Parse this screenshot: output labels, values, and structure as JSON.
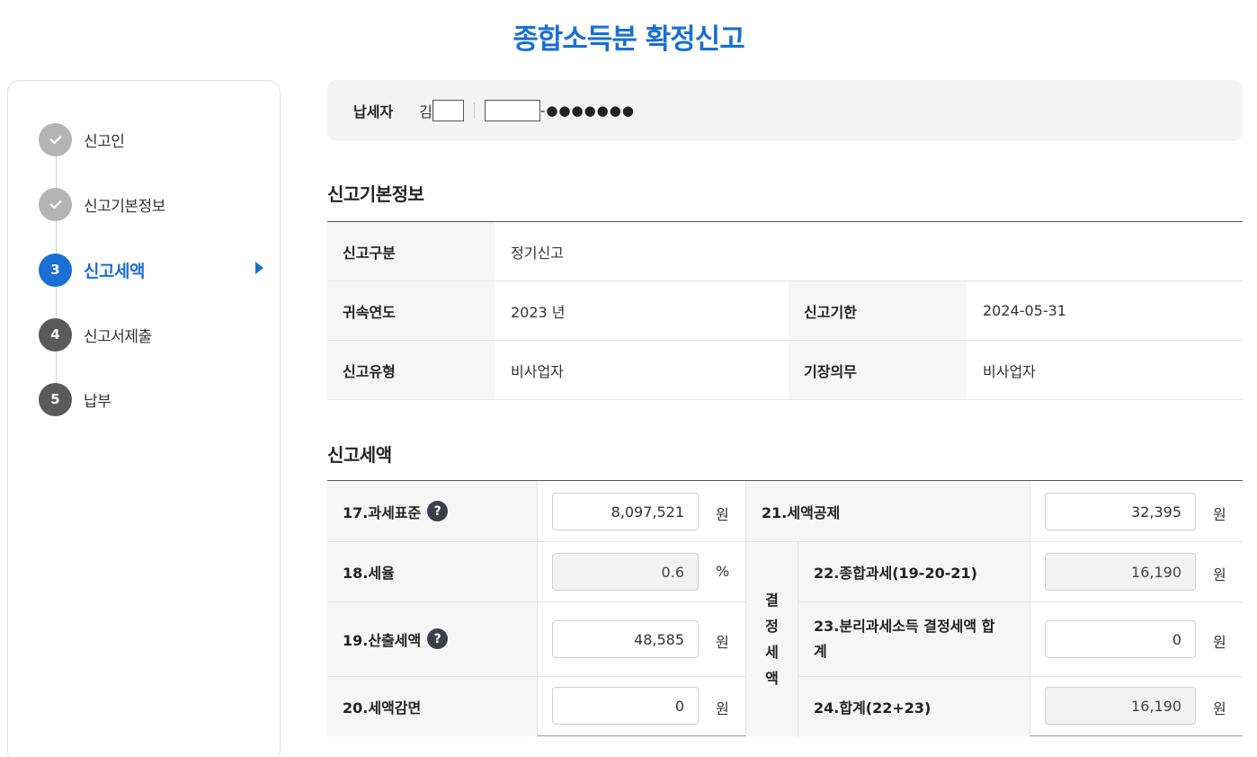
{
  "page": {
    "title": "종합소득분 확정신고"
  },
  "sidebar": {
    "steps": [
      {
        "num": "",
        "label": "신고인",
        "state": "done"
      },
      {
        "num": "",
        "label": "신고기본정보",
        "state": "done"
      },
      {
        "num": "3",
        "label": "신고세액",
        "state": "active"
      },
      {
        "num": "4",
        "label": "신고서제출",
        "state": "todo"
      },
      {
        "num": "5",
        "label": "납부",
        "state": "todo"
      }
    ]
  },
  "taxpayer": {
    "label": "납세자",
    "name_prefix": "김",
    "id_suffix": "-●●●●●●●"
  },
  "basic_info": {
    "section_title": "신고기본정보",
    "report_type_label": "신고구분",
    "report_type_value": "정기신고",
    "year_label": "귀속연도",
    "year_value": "2023 년",
    "deadline_label": "신고기한",
    "deadline_value": "2024-05-31",
    "filer_type_label": "신고유형",
    "filer_type_value": "비사업자",
    "bookkeeping_label": "기장의무",
    "bookkeeping_value": "비사업자"
  },
  "tax": {
    "section_title": "신고세액",
    "tax_base_label": "17.과세표준",
    "tax_base_value": "8,097,521",
    "tax_rate_label": "18.세율",
    "tax_rate_value": "0.6",
    "calc_tax_label": "19.산출세액",
    "calc_tax_value": "48,585",
    "reduction_label": "20.세액감면",
    "reduction_value": "0",
    "credit_label": "21.세액공제",
    "credit_value": "32,395",
    "determined_label_chars": [
      "결",
      "정",
      "세",
      "액"
    ],
    "comprehensive_label": "22.종합과세(19-20-21)",
    "comprehensive_value": "16,190",
    "separate_label_line1": "23.분리과세소득 결정세액 합",
    "separate_label_line2": "계",
    "separate_value": "0",
    "total_label": "24.합계(22+23)",
    "total_value": "16,190",
    "unit_won": "원",
    "unit_percent": "%",
    "help_glyph": "?"
  },
  "colors": {
    "accent": "#1a6fd4",
    "done_step": "#b4b4b4",
    "todo_step": "#5a5a5a",
    "header_bg": "#f6f6f6"
  }
}
